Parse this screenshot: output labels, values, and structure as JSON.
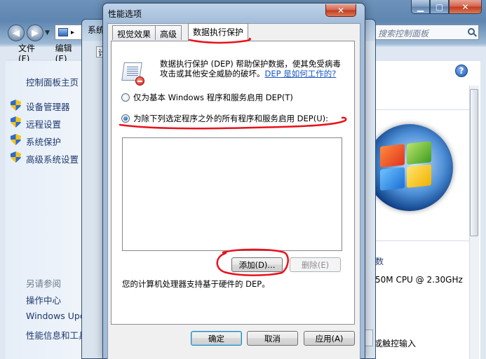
{
  "control_panel": {
    "search_placeholder": "搜索控制面板",
    "menu": [
      "文件(F)",
      "编辑(E)"
    ],
    "left_pane": {
      "home_link": "控制面板主页",
      "task_links": [
        "设备管理器",
        "远程设置",
        "系统保护",
        "高级系统设置"
      ],
      "see_also_heading": "另请参阅",
      "see_also_links": [
        "操作中心",
        "Windows Upd",
        "性能信息和工具"
      ]
    },
    "right_pane": {
      "partial_link": "数",
      "processor_text": "50M CPU @ 2.30GHz",
      "pen_text": "笔或触控输入"
    }
  },
  "system_properties": {
    "title_partial": "系统",
    "tab_partial": "计"
  },
  "dialog": {
    "title": "性能选项",
    "close_glyph": "✕",
    "tabs": [
      "视觉效果",
      "高级",
      "数据执行保护"
    ],
    "description": "数据执行保护 (DEP) 帮助保护数据，使其免受病毒攻击或其他安全威胁的破坏。",
    "help_link": "DEP 是如何工作的?",
    "option_basic": "仅为基本 Windows 程序和服务启用 DEP(T)",
    "option_all_except": "为除下列选定程序之外的所有程序和服务启用 DEP(U):",
    "selected_option": "option_all_except",
    "add_button": "添加(D)...",
    "remove_button": "删除(E)",
    "support_text": "您的计算机处理器支持基于硬件的 DEP。",
    "ok_button": "确定",
    "cancel_button": "取消",
    "apply_button": "应用(A)"
  },
  "colors": {
    "annotation": "#e8121c",
    "link": "#1a55c4"
  }
}
